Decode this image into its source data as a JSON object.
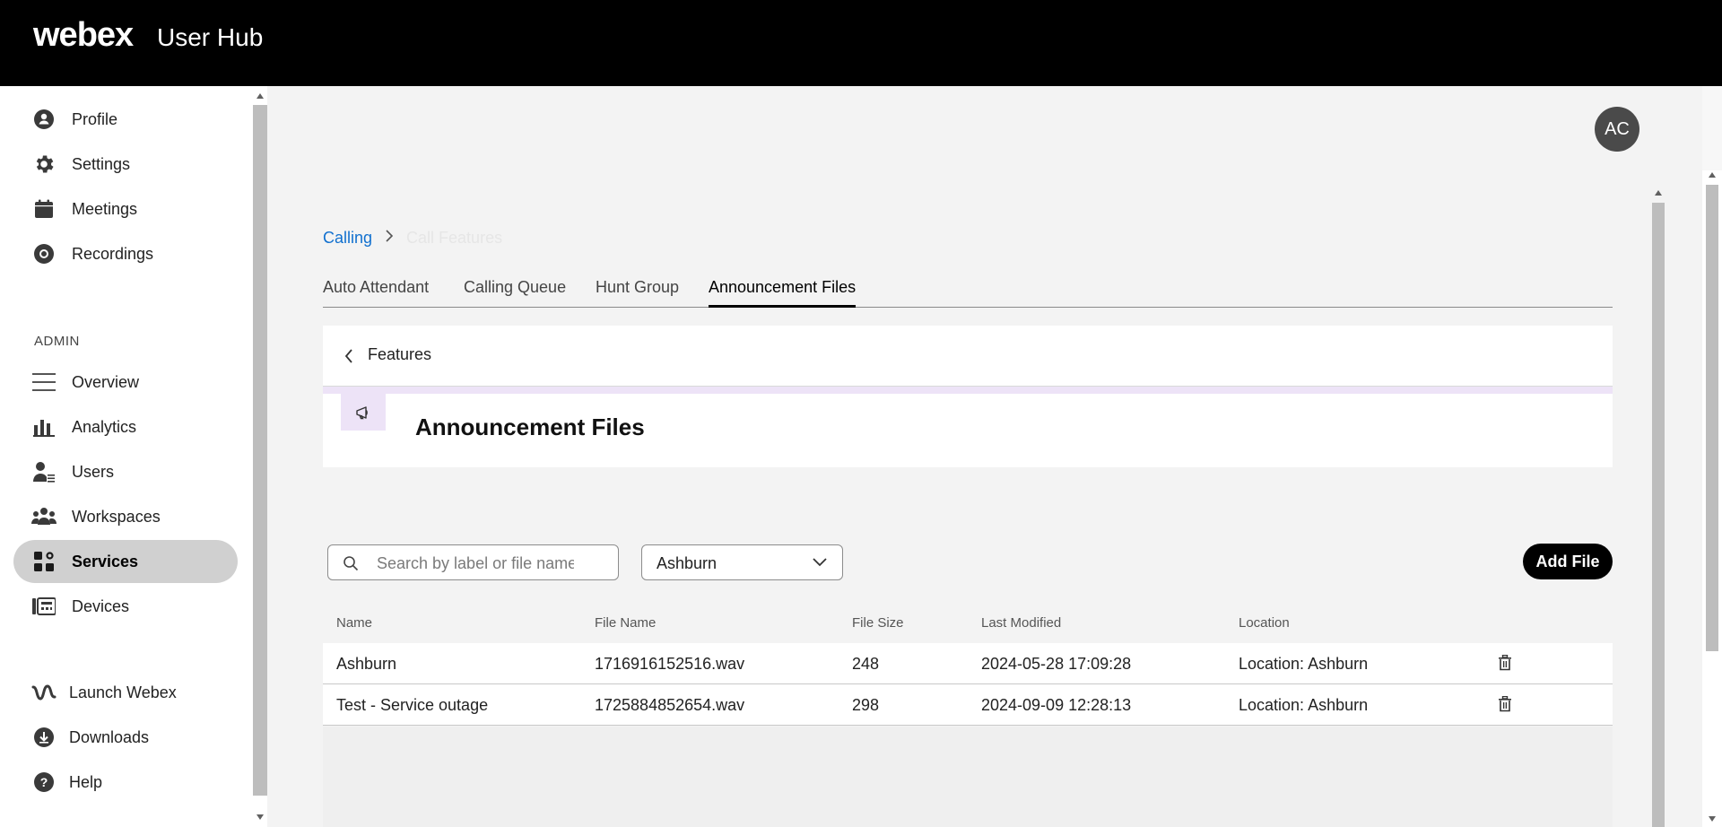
{
  "header": {
    "brand": "webex",
    "product": "User Hub"
  },
  "sidebar": {
    "items": [
      {
        "label": "Profile",
        "icon": "profile-icon"
      },
      {
        "label": "Settings",
        "icon": "gear-icon"
      },
      {
        "label": "Meetings",
        "icon": "calendar-icon"
      },
      {
        "label": "Recordings",
        "icon": "recording-icon"
      }
    ],
    "admin_label": "ADMIN",
    "admin_items": [
      {
        "label": "Overview",
        "icon": "menu-icon"
      },
      {
        "label": "Analytics",
        "icon": "analytics-icon"
      },
      {
        "label": "Users",
        "icon": "users-icon"
      },
      {
        "label": "Workspaces",
        "icon": "workspaces-icon"
      },
      {
        "label": "Services",
        "icon": "services-icon",
        "active": true
      },
      {
        "label": "Devices",
        "icon": "devices-icon"
      }
    ],
    "bottom_items": [
      {
        "label": "Launch Webex",
        "icon": "webex-icon"
      },
      {
        "label": "Downloads",
        "icon": "download-icon"
      },
      {
        "label": "Help",
        "icon": "help-icon"
      }
    ]
  },
  "user": {
    "initials": "AC"
  },
  "breadcrumb": {
    "parent": "Calling",
    "current": "Call Features"
  },
  "tabs": [
    "Auto Attendant",
    "Calling Queue",
    "Hunt Group",
    "Announcement Files"
  ],
  "active_tab": "Announcement Files",
  "panel": {
    "back_label": "Features",
    "title": "Announcement Files"
  },
  "search": {
    "placeholder": "Search by label or file name",
    "value": ""
  },
  "location_filter": {
    "selected": "Ashburn"
  },
  "add_button": "Add File",
  "table": {
    "columns": [
      "Name",
      "File Name",
      "File Size",
      "Last Modified",
      "Location"
    ],
    "rows": [
      {
        "name": "Ashburn",
        "file_name": "1716916152516.wav",
        "file_size": "248",
        "last_modified": "2024-05-28 17:09:28",
        "location": "Location: Ashburn"
      },
      {
        "name": "Test - Service outage",
        "file_name": "1725884852654.wav",
        "file_size": "298",
        "last_modified": "2024-09-09 12:28:13",
        "location": "Location: Ashburn"
      }
    ]
  },
  "colors": {
    "accent_link": "#1170cf",
    "active_nav": "#d0d0d0",
    "icon_tint": "#ede3f7",
    "header_bg": "#000000"
  }
}
